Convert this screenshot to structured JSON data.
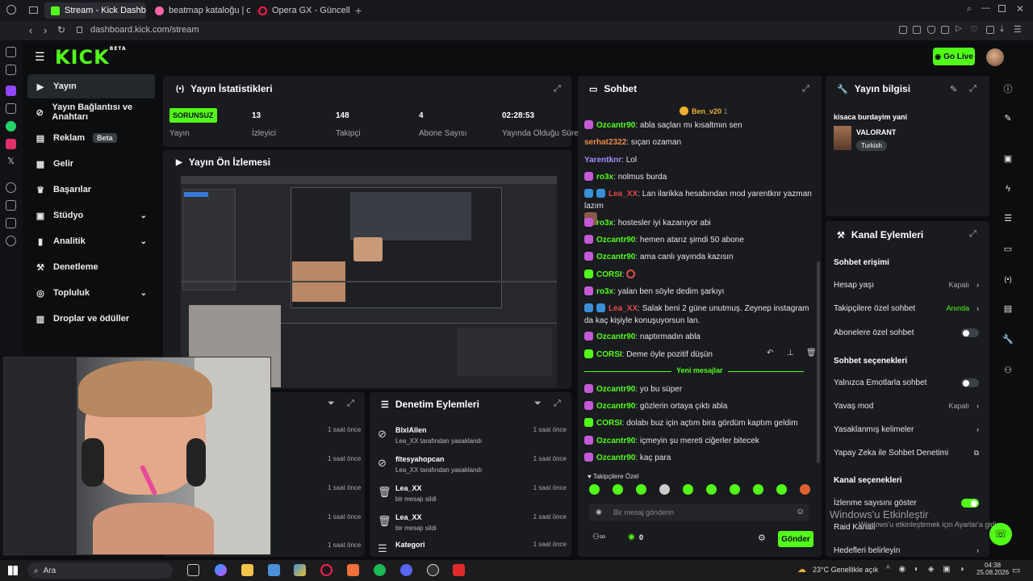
{
  "browser": {
    "tabs": [
      {
        "label": "Stream - Kick Dashboard",
        "icon_color": "#53fc18"
      },
      {
        "label": "beatmap kataloğu | osu!",
        "icon_color": "#ff66aa"
      },
      {
        "label": "Opera GX - Güncelleme tar",
        "icon_color": "#fa1e4e"
      }
    ],
    "url": "dashboard.kick.com/stream"
  },
  "header": {
    "logo": "KICK",
    "logo_beta": "BETA",
    "go_live": "Go Live"
  },
  "nav": {
    "items": [
      {
        "label": "Yayın",
        "icon": "play-icon"
      },
      {
        "label": "Yayın Bağlantısı ve Anahtarı",
        "icon": "link-icon"
      },
      {
        "label": "Reklam",
        "icon": "ad-icon",
        "badge": "Beta"
      },
      {
        "label": "Gelir",
        "icon": "money-icon"
      },
      {
        "label": "Başarılar",
        "icon": "trophy-icon"
      },
      {
        "label": "Stüdyo",
        "icon": "studio-icon",
        "expand": true
      },
      {
        "label": "Analitik",
        "icon": "chart-icon",
        "expand": true
      },
      {
        "label": "Denetleme",
        "icon": "hammer-icon"
      },
      {
        "label": "Topluluk",
        "icon": "community-icon",
        "expand": true
      },
      {
        "label": "Droplar ve ödüller",
        "icon": "gift-icon"
      }
    ]
  },
  "stats": {
    "title": "Yayın İstatistikleri",
    "items": [
      {
        "value": "SORUNSUZ",
        "label": "Yayın"
      },
      {
        "value": "13",
        "label": "İzleyici"
      },
      {
        "value": "148",
        "label": "Takipçi"
      },
      {
        "value": "4",
        "label": "Abone Sayısı"
      },
      {
        "value": "02:28:53",
        "label": "Yayında Olduğu Süre"
      }
    ]
  },
  "preview": {
    "title": "Yayın Ön İzlemesi"
  },
  "chat": {
    "title": "Sohbet",
    "pinned_user": "Ben_v20",
    "pinned_count": "1",
    "messages": [
      {
        "user": "Ozcantr90",
        "text": "abla saçları mı kısaltmın sen",
        "color": "green",
        "badge": "pink"
      },
      {
        "user": "serhat2322",
        "text": "sıçan ozaman",
        "color": "red",
        "badge": ""
      },
      {
        "user": "Yarentknr",
        "text": "Lol",
        "color": "purple",
        "badge": ""
      },
      {
        "user": "ro3x",
        "text": "nolmus burda",
        "color": "green",
        "badge": "pink"
      },
      {
        "user": "Lea_XX",
        "text": "Lan ilarikka hesabından mod yarentknr yazman lazım",
        "color": "red",
        "badge": "blue"
      },
      {
        "user": "ro3x",
        "text": "hostesler iyi kazanıyor abi",
        "color": "green",
        "badge": "pink"
      },
      {
        "user": "Ozcantr90",
        "text": "hemen atarız şimdi 50 abone",
        "color": "green",
        "badge": "pink"
      },
      {
        "user": "Ozcantr90",
        "text": "ama canlı yayında kazısın",
        "color": "green",
        "badge": "pink"
      },
      {
        "user": "CORSI",
        "text": "",
        "color": "green",
        "badge": "green"
      },
      {
        "user": "ro3x",
        "text": "yalan ben söyle dedim şarkıyı",
        "color": "green",
        "badge": "pink"
      },
      {
        "user": "Lea_XX",
        "text": "Salak beni 2 güne unutmuş. Zeynep instagram da kaç kişiyle konuşuyorsun lan.",
        "color": "red",
        "badge": "blue"
      },
      {
        "user": "Ozcantr90",
        "text": "naptırmadın abla",
        "color": "green",
        "badge": "pink"
      },
      {
        "user": "CORSI",
        "text": "Deme öyle pozitif düşün",
        "color": "green",
        "badge": "green"
      }
    ],
    "new_messages_label": "Yeni mesajlar",
    "new_messages": [
      {
        "user": "Ozcantr90",
        "text": "yo bu süper",
        "color": "green",
        "badge": "pink"
      },
      {
        "user": "Ozcantr90",
        "text": "gözlerin ortaya çıktı abla",
        "color": "green",
        "badge": "pink"
      },
      {
        "user": "CORSI",
        "text": "dolabı buz için açtım bira gördüm kaptım geldim",
        "color": "green",
        "badge": "green"
      },
      {
        "user": "Ozcantr90",
        "text": "içmeyin şu mereti ciğerler bitecek",
        "color": "green",
        "badge": "pink"
      },
      {
        "user": "Ozcantr90",
        "text": "kaç para",
        "color": "green",
        "badge": "pink"
      }
    ],
    "followers_only": "Takipçilere Özel",
    "input_placeholder": "Bir mesaj gönderin",
    "points": "0",
    "send": "Gönder"
  },
  "stream_info": {
    "title": "Yayın bilgisi",
    "stream_title": "kisaca burdayim yani",
    "category": "VALORANT",
    "language": "Turkish"
  },
  "channel_actions": {
    "title": "Kanal Eylemleri",
    "chat_access": "Sohbet erişimi",
    "account_age": "Hesap yaşı",
    "account_age_value": "Kapalı",
    "followers_chat": "Takipçilere özel sohbet",
    "followers_chat_value": "Anında",
    "subscribers_chat": "Abonelere özel sohbet",
    "chat_options": "Sohbet seçenekleri",
    "emote_only": "Yalnızca Emotlarla sohbet",
    "slow_mode": "Yavaş mod",
    "slow_mode_value": "Kapalı",
    "banned_words": "Yasaklanmış kelimeler",
    "ai_moderation": "Yapay Zeka ile Sohbet Denetimi",
    "channel_options": "Kanal seçenekleri",
    "show_viewers": "İzlenme sayısını göster",
    "raid_channel": "Raid Kanalı",
    "goals": "Hedefleri belirleyin"
  },
  "moderation": {
    "title": "Denetim Eylemleri",
    "rows": [
      {
        "name": "BlxlAllen",
        "action": "Lea_XX tarafından yasaklandı",
        "time": "1 saat önce",
        "icon": "ban-icon"
      },
      {
        "name": "fltesyahopcan",
        "action": "Lea_XX tarafından yasaklandı",
        "time": "1 saat önce",
        "icon": "ban-icon"
      },
      {
        "name": "Lea_XX",
        "action": "bir mesajı sildi",
        "time": "1 saat önce",
        "icon": "trash-icon"
      },
      {
        "name": "Lea_XX",
        "action": "bir mesajı sildi",
        "time": "1 saat önce",
        "icon": "trash-icon"
      },
      {
        "name": "Kategori",
        "action": "",
        "time": "1 saat önce",
        "icon": "list-icon"
      }
    ],
    "left_times": [
      "1 saat önce",
      "1 saat önce",
      "1 saat önce",
      "1 saat önce",
      "1 saat önce"
    ]
  },
  "windows_activation": {
    "title": "Windows'u Etkinleştir",
    "subtitle": "Windows'u etkinleştirmek için Ayarlar'a gidin."
  },
  "taskbar": {
    "search": "Ara",
    "weather": "23°C  Genellikle açık",
    "time": "04:38",
    "date": "25.08.2026"
  },
  "colors": {
    "accent": "#53fc18",
    "panel": "#191b1f",
    "bg": "#0b0d0f"
  }
}
